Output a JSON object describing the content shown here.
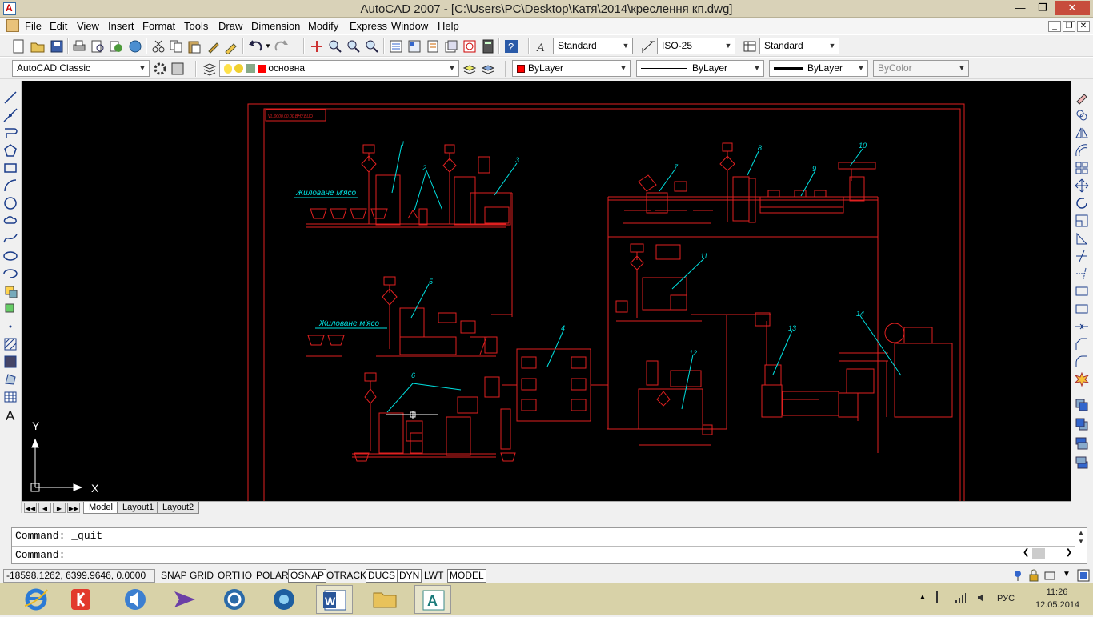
{
  "window": {
    "title": "AutoCAD 2007 - [C:\\Users\\PC\\Desktop\\Катя\\2014\\креслення кп.dwg]"
  },
  "menu": [
    "File",
    "Edit",
    "View",
    "Insert",
    "Format",
    "Tools",
    "Draw",
    "Dimension",
    "Modify",
    "Express",
    "Window",
    "Help"
  ],
  "styles": {
    "text_style": "Standard",
    "dim_style": "ISO-25",
    "table_style": "Standard"
  },
  "workspace": "AutoCAD Classic",
  "layer": {
    "name": "основна",
    "color": "#ff0000"
  },
  "properties": {
    "color": "ByLayer",
    "linetype": "ByLayer",
    "lineweight": "ByLayer",
    "plotstyle": "ByColor"
  },
  "ucs": {
    "y_label": "Y",
    "x_label": "X"
  },
  "drawing": {
    "stamp": "VL.0000.00.00.ВНУ.ВЦО",
    "text_upper": "Жиловане м'ясо",
    "text_lower": "Жиловане м'ясо",
    "labels": [
      "1",
      "2",
      "3",
      "4",
      "5",
      "6",
      "7",
      "8",
      "9",
      "10",
      "11",
      "12",
      "13",
      "14"
    ]
  },
  "tabs": [
    "Model",
    "Layout1",
    "Layout2"
  ],
  "command": {
    "line1": "Command: _quit",
    "line2": "Command:"
  },
  "status": {
    "coords": "-18598.1262, 6399.9646, 0.0000",
    "toggles": [
      "SNAP",
      "GRID",
      "ORTHO",
      "POLAR",
      "OSNAP",
      "OTRACK",
      "DUCS",
      "DYN",
      "LWT",
      "MODEL"
    ]
  },
  "tray": {
    "lang": "РУС",
    "time": "11:26",
    "date": "12.05.2014"
  }
}
